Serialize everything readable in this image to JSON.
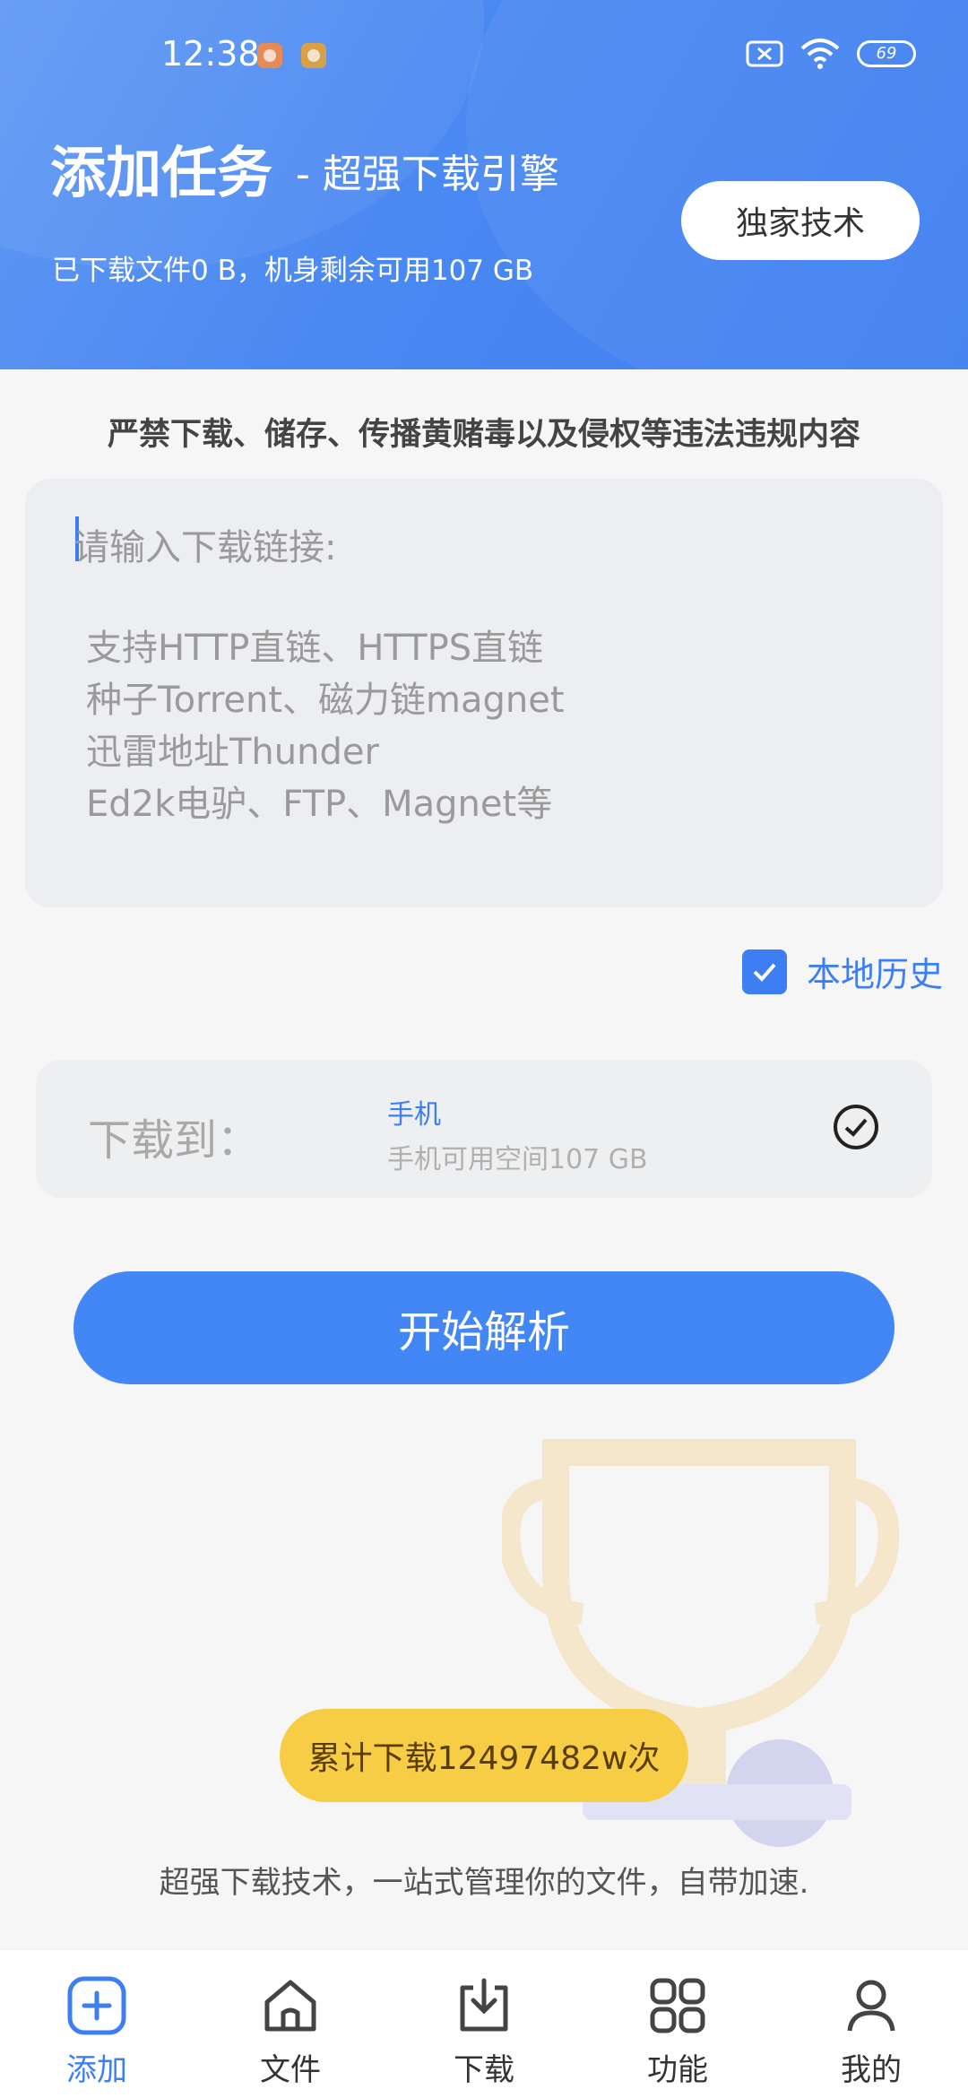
{
  "status_bar": {
    "time": "12:38",
    "battery": "69"
  },
  "header": {
    "title": "添加任务",
    "subtitle": "- 超强下载引擎",
    "storage_info": "已下载文件0 B，机身剩余可用107 GB",
    "tech_button": "独家技术"
  },
  "notice": "严禁下载、储存、传播黄赌毒以及侵权等违法违规内容",
  "link_input": {
    "placeholder": "请输入下载链接:",
    "hints": [
      "支持HTTP直链、HTTPS直链",
      "种子Torrent、磁力链magnet",
      "迅雷地址Thunder",
      "Ed2k电驴、FTP、Magnet等"
    ]
  },
  "local_history": {
    "label": "本地历史",
    "checked": true
  },
  "destination": {
    "label": "下载到：",
    "name": "手机",
    "space": "手机可用空间107 GB"
  },
  "start_button": "开始解析",
  "stats_badge": "累计下载12497482w次",
  "slogan": "超强下载技术，一站式管理你的文件，自带加速.",
  "tabs": [
    {
      "label": "添加",
      "icon": "add-square-icon",
      "active": true
    },
    {
      "label": "文件",
      "icon": "home-icon",
      "active": false
    },
    {
      "label": "下载",
      "icon": "download-icon",
      "active": false
    },
    {
      "label": "功能",
      "icon": "grid-icon",
      "active": false
    },
    {
      "label": "我的",
      "icon": "user-icon",
      "active": false
    }
  ],
  "colors": {
    "accent": "#4287f5",
    "badge": "#f7cd45"
  }
}
